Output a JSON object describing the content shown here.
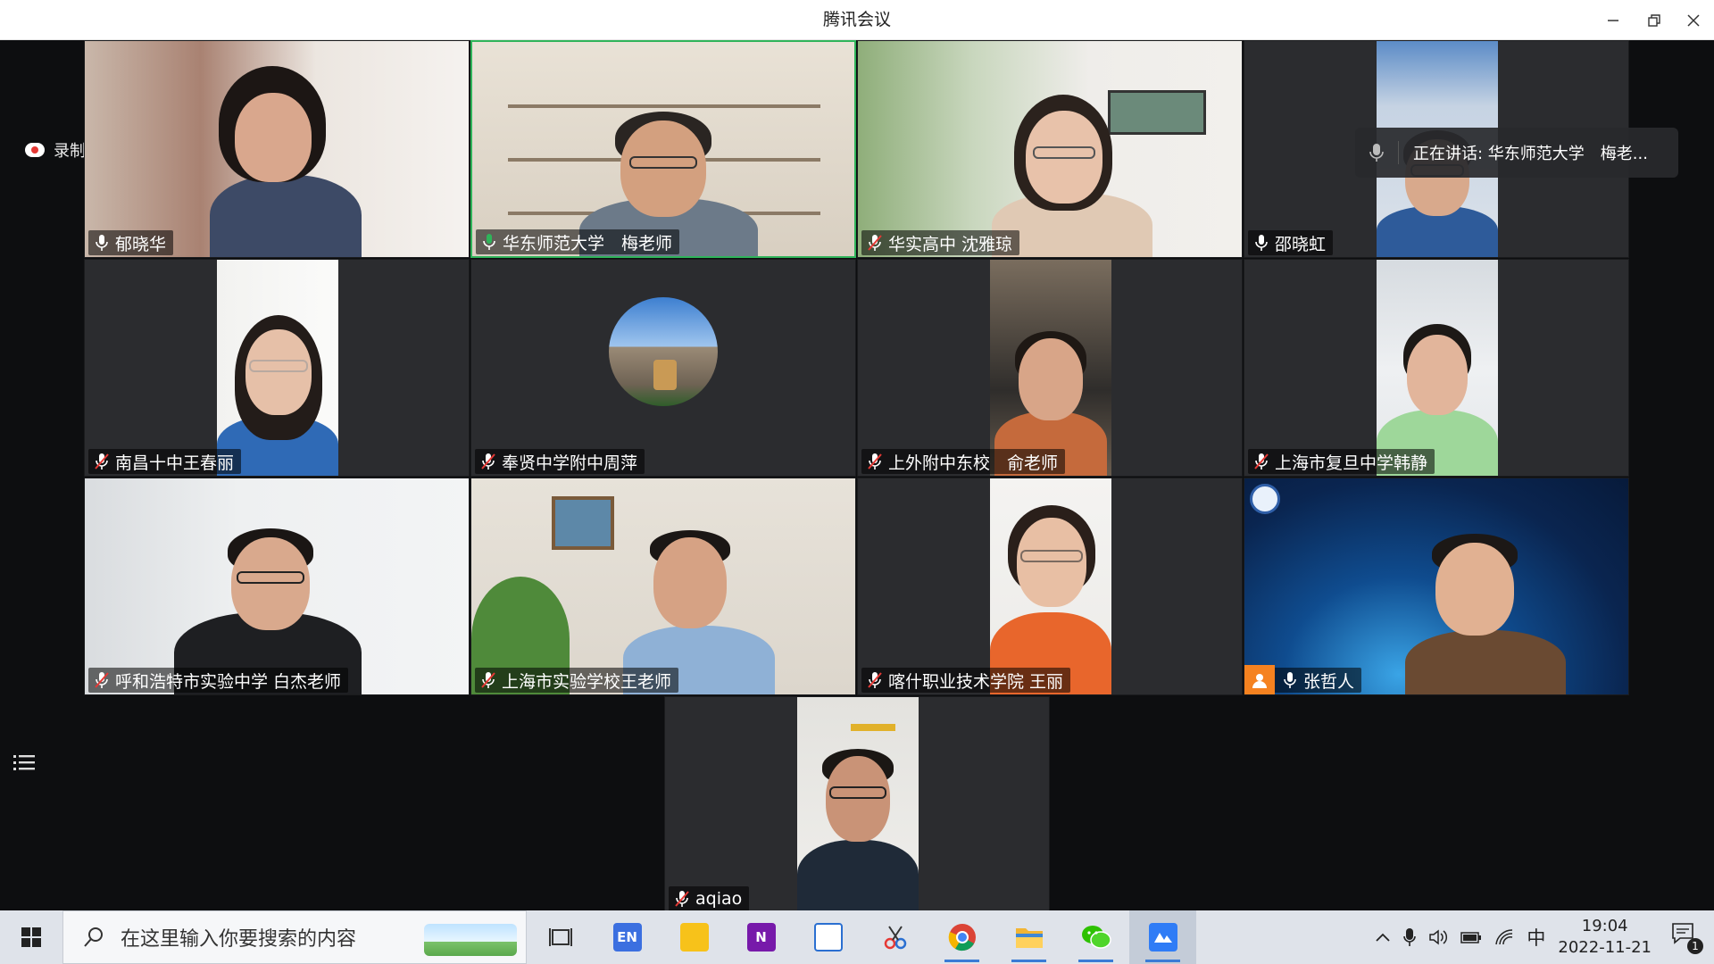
{
  "window": {
    "title": "腾讯会议"
  },
  "recording": {
    "label": "录制中"
  },
  "speaking": {
    "label": "正在讲话: 华东师范大学　梅老..."
  },
  "participants": [
    {
      "name": "郁晓华",
      "mic": "on"
    },
    {
      "name": "华东师范大学　梅老师",
      "mic": "speaking"
    },
    {
      "name": "华实高中 沈雅琼",
      "mic": "muted"
    },
    {
      "name": "邵晓虹",
      "mic": "on"
    },
    {
      "name": "南昌十中王春丽",
      "mic": "muted"
    },
    {
      "name": "奉贤中学附中周萍",
      "mic": "muted"
    },
    {
      "name": "上外附中东校　俞老师",
      "mic": "muted"
    },
    {
      "name": "上海市复旦中学韩静",
      "mic": "muted"
    },
    {
      "name": "呼和浩特市实验中学 白杰老师",
      "mic": "muted"
    },
    {
      "name": "上海市实验学校王老师",
      "mic": "muted"
    },
    {
      "name": "喀什职业技术学院 王丽",
      "mic": "muted"
    },
    {
      "name": "张哲人",
      "mic": "on",
      "host": true
    },
    {
      "name": "aqiao",
      "mic": "muted"
    }
  ],
  "taskbar": {
    "search_placeholder": "在这里输入你要搜索的内容",
    "apps": [
      "task-view",
      "en-dictionary",
      "sticky-notes",
      "onenote",
      "whiteboard",
      "snipping-tool",
      "chrome",
      "file-explorer",
      "wechat",
      "tencent-meeting"
    ],
    "en_label": "EN",
    "onenote_label": "N",
    "ime": "中",
    "time": "19:04",
    "date": "2022-11-21",
    "notifications": "1"
  },
  "colors": {
    "speaking_green": "#2fb45a",
    "recording_red": "#e53935",
    "accent_blue": "#3a7bd5"
  }
}
